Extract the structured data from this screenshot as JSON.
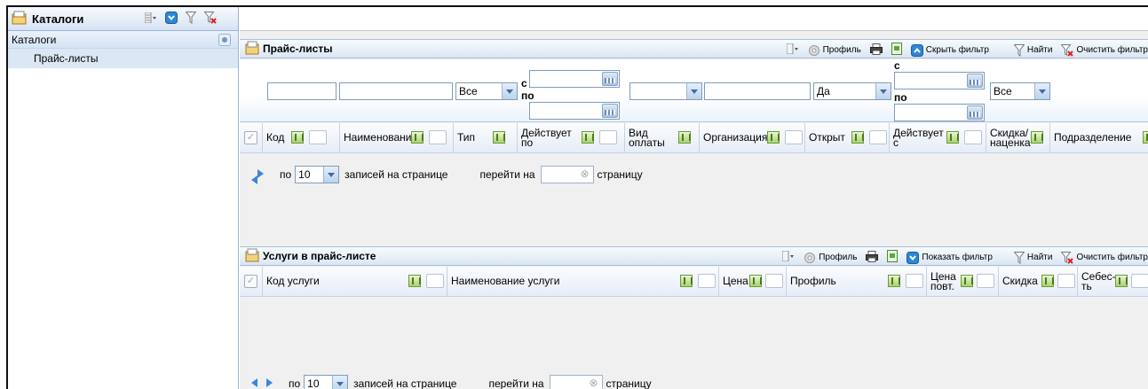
{
  "left_panel": {
    "title": "Каталоги",
    "tree_root": "Каталоги",
    "items": [
      {
        "label": "Прайс-листы"
      }
    ]
  },
  "price_lists": {
    "title": "Прайс-листы",
    "toolbar": {
      "profile": "Профиль",
      "hide_filter": "Скрыть фильтр",
      "find": "Найти",
      "clear_filter": "Очистить фильтр"
    },
    "filter": {
      "type_value": "Все",
      "from_label": "с",
      "to_label": "по",
      "open_value": "Да",
      "discount_value": "Все"
    },
    "columns": [
      "Код",
      "Наименование",
      "Тип",
      "Действует по",
      "Вид оплаты",
      "Организация",
      "Открыт",
      "Действует с",
      "Скидка/ наценка",
      "Подразделение"
    ],
    "pager": {
      "per_page_prefix": "по",
      "per_page_value": "10",
      "per_page_suffix": "записей на странице",
      "goto_prefix": "перейти на",
      "goto_suffix": "страницу"
    }
  },
  "services": {
    "title": "Услуги в прайс-листе",
    "toolbar": {
      "profile": "Профиль",
      "show_filter": "Показать фильтр",
      "find": "Найти",
      "clear_filter": "Очистить фильтр"
    },
    "columns": [
      "Код услуги",
      "Наименование услуги",
      "Цена",
      "Профиль",
      "Цена повт.",
      "Скидка",
      "Себес-ть"
    ],
    "pager": {
      "per_page_prefix": "по",
      "per_page_value": "10",
      "per_page_suffix": "записей на странице",
      "goto_prefix": "перейти на",
      "goto_suffix": "страницу"
    }
  },
  "colors": {
    "header_blue": "#dae6f3",
    "selection": "#dbe7f4",
    "accent": "#1e78c8"
  }
}
